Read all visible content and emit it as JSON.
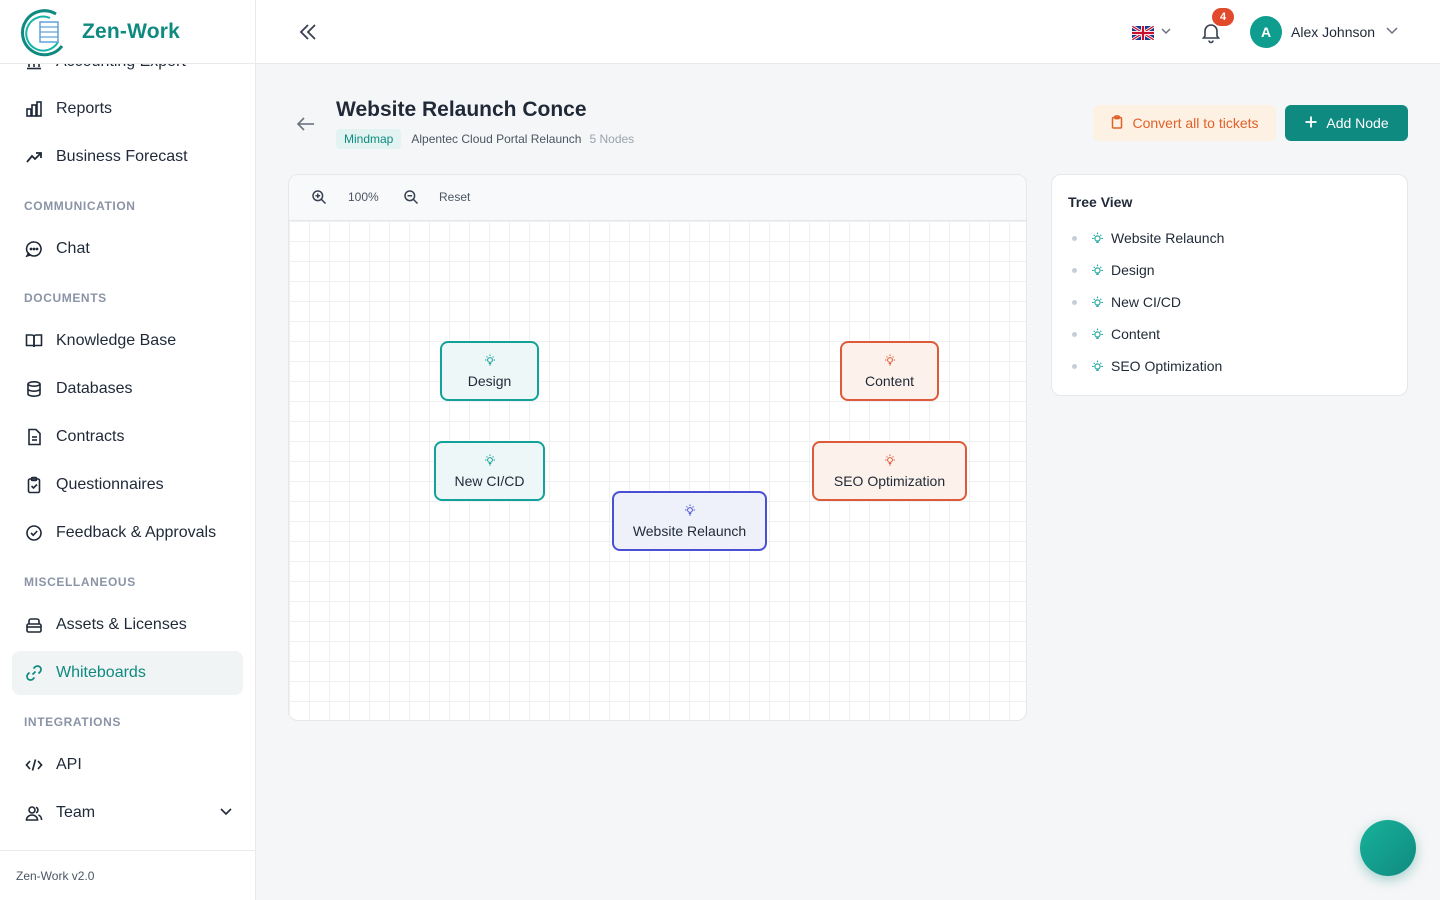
{
  "brand": {
    "name": "Zen-Work",
    "footer": "Zen-Work v2.0"
  },
  "sidebar": {
    "items": [
      {
        "label": "Accounting Export",
        "icon": "bank-icon"
      },
      {
        "label": "Reports",
        "icon": "bar-chart-icon"
      },
      {
        "label": "Business Forecast",
        "icon": "trend-up-icon"
      },
      {
        "label": "Chat",
        "icon": "chat-icon"
      },
      {
        "label": "Knowledge Base",
        "icon": "book-icon"
      },
      {
        "label": "Databases",
        "icon": "database-icon"
      },
      {
        "label": "Contracts",
        "icon": "document-icon"
      },
      {
        "label": "Questionnaires",
        "icon": "clipboard-icon"
      },
      {
        "label": "Feedback & Approvals",
        "icon": "check-circle-icon"
      },
      {
        "label": "Assets & Licenses",
        "icon": "box-icon"
      },
      {
        "label": "Whiteboards",
        "icon": "link-icon"
      },
      {
        "label": "API",
        "icon": "code-icon"
      },
      {
        "label": "Team",
        "icon": "users-icon"
      }
    ],
    "sections": {
      "communication": "COMMUNICATION",
      "documents": "DOCUMENTS",
      "miscellaneous": "MISCELLANEOUS",
      "integrations": "INTEGRATIONS"
    }
  },
  "topbar": {
    "user_name": "Alex Johnson",
    "avatar_initial": "A",
    "notifications_count": "4"
  },
  "page": {
    "title": "Website Relaunch Conce",
    "type_chip": "Mindmap",
    "project": "Alpentec Cloud Portal Relaunch",
    "node_count": "5 Nodes",
    "convert_label": "Convert all to tickets",
    "add_node_label": "Add Node"
  },
  "canvas": {
    "zoom_level": "100%",
    "reset_label": "Reset",
    "nodes": [
      {
        "label": "Design",
        "color": "teal"
      },
      {
        "label": "Content",
        "color": "orange"
      },
      {
        "label": "New CI/CD",
        "color": "teal"
      },
      {
        "label": "SEO Optimization",
        "color": "orange"
      },
      {
        "label": "Website Relaunch",
        "color": "blue"
      }
    ]
  },
  "tree": {
    "title": "Tree View",
    "items": [
      "Website Relaunch",
      "Design",
      "New CI/CD",
      "Content",
      "SEO Optimization"
    ]
  },
  "colors": {
    "brand": "#0f8a80",
    "teal_node": "#14a19a",
    "orange_node": "#dd5a3a",
    "blue_node": "#4950d3",
    "badge": "#e14b2c",
    "convert_bg": "#fdf1e3"
  }
}
